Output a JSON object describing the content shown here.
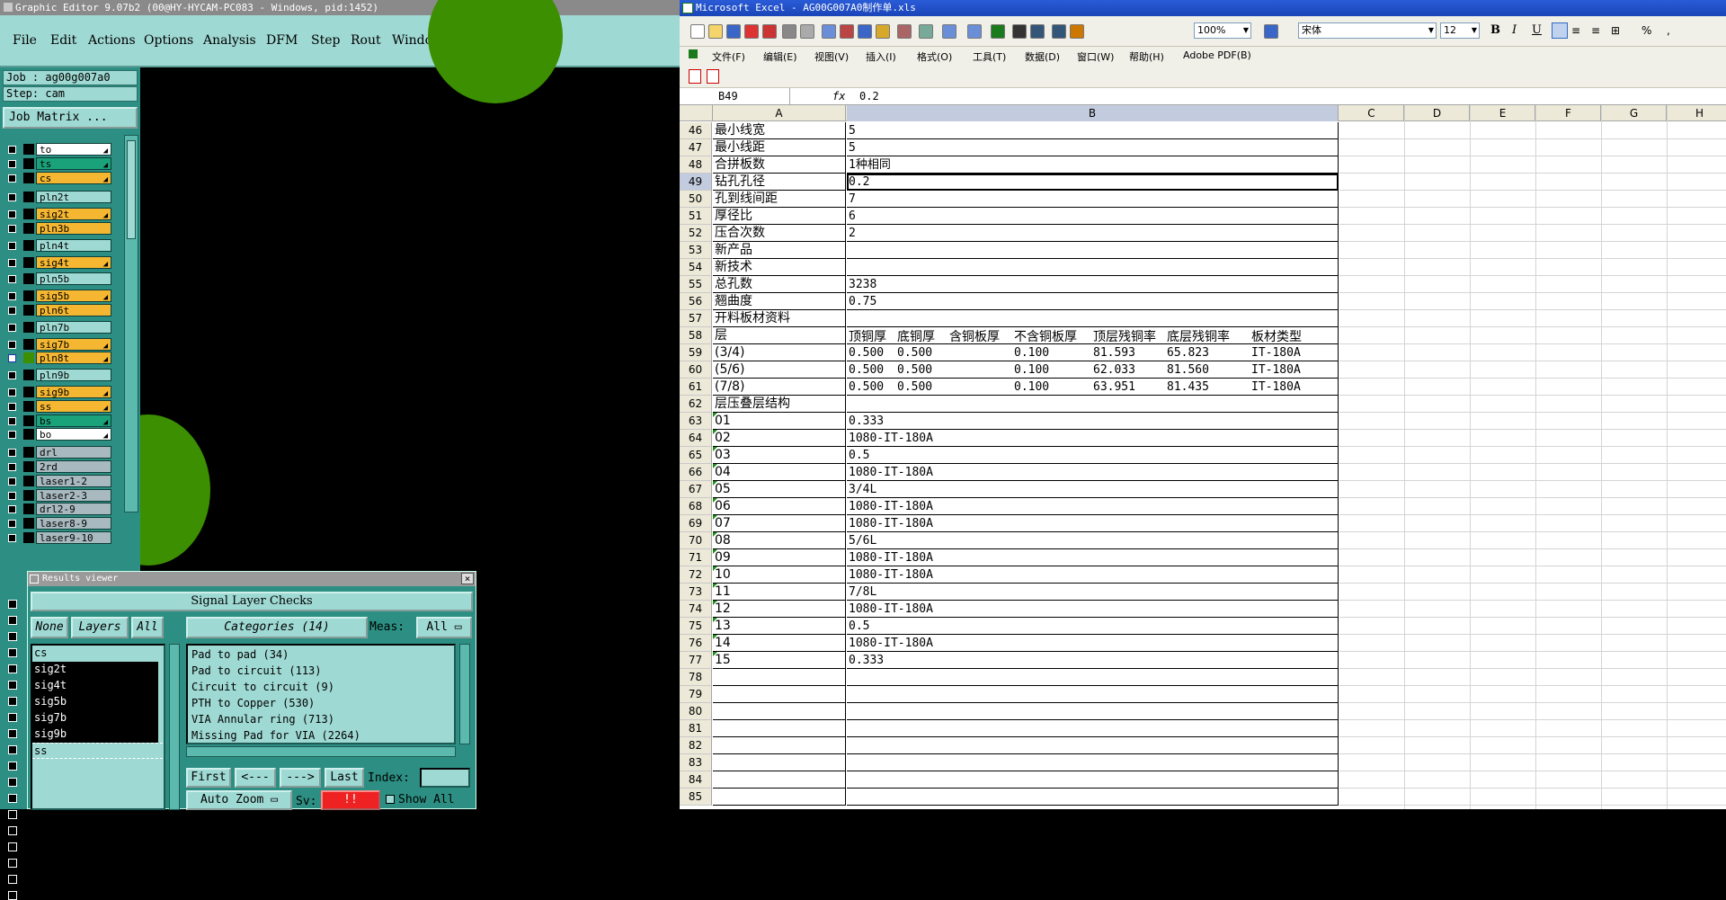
{
  "ge": {
    "title": "Graphic Editor 9.07b2 (00@HY-HYCAM-PC083 - Windows, pid:1452)",
    "menu": [
      "File",
      "Edit",
      "Actions",
      "Options",
      "Analysis",
      "DFM",
      "Step",
      "Rout",
      "Windows"
    ],
    "job": "Job : ag00g007a0",
    "step": "Step: cam",
    "job_matrix": "Job Matrix ...",
    "layers": [
      {
        "name": "to",
        "color": "#ffffff",
        "checked": false,
        "arrow": true
      },
      {
        "name": "ts",
        "color": "#1aa37a",
        "checked": false,
        "arrow": true
      },
      {
        "name": "cs",
        "color": "#f5b731",
        "checked": false,
        "arrow": true
      },
      {
        "name": "pln2t",
        "color": "#9fd9d3",
        "checked": false,
        "arrow": false
      },
      {
        "name": "sig2t",
        "color": "#f5b731",
        "checked": false,
        "arrow": true
      },
      {
        "name": "pln3b",
        "color": "#f5b731",
        "checked": false,
        "arrow": false
      },
      {
        "name": "pln4t",
        "color": "#9fd9d3",
        "checked": false,
        "arrow": false
      },
      {
        "name": "sig4t",
        "color": "#f5b731",
        "checked": false,
        "arrow": true
      },
      {
        "name": "pln5b",
        "color": "#9fd9d3",
        "checked": false,
        "arrow": false
      },
      {
        "name": "sig5b",
        "color": "#f5b731",
        "checked": false,
        "arrow": true
      },
      {
        "name": "pln6t",
        "color": "#f5b731",
        "checked": false,
        "arrow": false
      },
      {
        "name": "pln7b",
        "color": "#9fd9d3",
        "checked": false,
        "arrow": false
      },
      {
        "name": "sig7b",
        "color": "#f5b731",
        "checked": false,
        "arrow": true
      },
      {
        "name": "pln8t",
        "color": "#f5b731",
        "checked": true,
        "arrow": true
      },
      {
        "name": "pln9b",
        "color": "#9fd9d3",
        "checked": false,
        "arrow": false
      },
      {
        "name": "sig9b",
        "color": "#f5b731",
        "checked": false,
        "arrow": true
      },
      {
        "name": "ss",
        "color": "#f5b731",
        "checked": false,
        "arrow": true
      },
      {
        "name": "bs",
        "color": "#1aa37a",
        "checked": false,
        "arrow": true
      },
      {
        "name": "bo",
        "color": "#ffffff",
        "checked": false,
        "arrow": true
      },
      {
        "name": "drl",
        "color": "#a9b9c0",
        "checked": false,
        "arrow": false
      },
      {
        "name": "2rd",
        "color": "#a9b9c0",
        "checked": false,
        "arrow": false
      },
      {
        "name": "laser1-2",
        "color": "#a9b9c0",
        "checked": false,
        "arrow": false
      },
      {
        "name": "laser2-3",
        "color": "#a9b9c0",
        "checked": false,
        "arrow": false
      },
      {
        "name": "drl2-9",
        "color": "#a9b9c0",
        "checked": false,
        "arrow": false
      },
      {
        "name": "laser8-9",
        "color": "#a9b9c0",
        "checked": false,
        "arrow": false
      },
      {
        "name": "laser9-10",
        "color": "#a9b9c0",
        "checked": false,
        "arrow": false
      }
    ],
    "results": {
      "title": "Results viewer",
      "header": "Signal Layer Checks",
      "none": "None",
      "layers_btn": "Layers",
      "all": "All",
      "categories_btn": "Categories (14)",
      "meas_label": "Meas:",
      "meas_value": "All",
      "layer_list": [
        {
          "name": "cs",
          "sel": false
        },
        {
          "name": "sig2t",
          "sel": true
        },
        {
          "name": "sig4t",
          "sel": true
        },
        {
          "name": "sig5b",
          "sel": true
        },
        {
          "name": "sig7b",
          "sel": true
        },
        {
          "name": "sig9b",
          "sel": true
        },
        {
          "name": "ss",
          "sel": false
        }
      ],
      "categories": [
        "Pad to pad (34)",
        "Pad to circuit (113)",
        "Circuit to circuit (9)",
        "PTH to Copper (530)",
        "VIA Annular ring (713)",
        "Missing Pad for VIA (2264)"
      ],
      "first": "First",
      "prev": "<---",
      "next": "--->",
      "last": "Last",
      "index": "Index:",
      "auto_zoom": "Auto Zoom",
      "sv": "Sv:",
      "sv_value": "!!",
      "show_all": "Show All"
    }
  },
  "xl": {
    "title": "Microsoft Excel - AG00G007A0制作单.xls",
    "menu": [
      "文件(F)",
      "编辑(E)",
      "视图(V)",
      "插入(I)",
      "格式(O)",
      "工具(T)",
      "数据(D)",
      "窗口(W)",
      "帮助(H)",
      "Adobe PDF(B)"
    ],
    "zoom": "100%",
    "font": "宋体",
    "font_size": "12",
    "name_box": "B49",
    "fx": "fx",
    "formula": "0.2",
    "columns": [
      "A",
      "B",
      "C",
      "D",
      "E",
      "F",
      "G",
      "H"
    ],
    "rows": [
      {
        "n": "46",
        "a": "最小线宽",
        "b": "5"
      },
      {
        "n": "47",
        "a": "最小线距",
        "b": "5"
      },
      {
        "n": "48",
        "a": "合拼板数",
        "b": "1种相同"
      },
      {
        "n": "49",
        "a": "钻孔孔径",
        "b": "0.2",
        "sel": true
      },
      {
        "n": "50",
        "a": "孔到线间距",
        "b": "7"
      },
      {
        "n": "51",
        "a": "厚径比",
        "b": "6"
      },
      {
        "n": "52",
        "a": "压合次数",
        "b": "2"
      },
      {
        "n": "53",
        "a": "新产品",
        "b": ""
      },
      {
        "n": "54",
        "a": "新技术",
        "b": ""
      },
      {
        "n": "55",
        "a": "总孔数",
        "b": "3238"
      },
      {
        "n": "56",
        "a": "翘曲度",
        "b": "0.75"
      },
      {
        "n": "57",
        "a": "开料板材资料",
        "b": ""
      },
      {
        "n": "58",
        "a": "层",
        "b": "",
        "subs": [
          "顶铜厚",
          "底铜厚",
          "含铜板厚",
          "不含铜板厚",
          "顶层残铜率",
          "底层残铜率",
          "板材类型"
        ],
        "hdr": true
      },
      {
        "n": "59",
        "a": "(3/4)",
        "b": "",
        "subs": [
          "0.500",
          "0.500",
          "",
          "0.100",
          "81.593",
          "65.823",
          "IT-180A"
        ]
      },
      {
        "n": "60",
        "a": "(5/6)",
        "b": "",
        "subs": [
          "0.500",
          "0.500",
          "",
          "0.100",
          "62.033",
          "81.560",
          "IT-180A"
        ]
      },
      {
        "n": "61",
        "a": "(7/8)",
        "b": "",
        "subs": [
          "0.500",
          "0.500",
          "",
          "0.100",
          "63.951",
          "81.435",
          "IT-180A"
        ]
      },
      {
        "n": "62",
        "a": "层压叠层结构",
        "b": ""
      },
      {
        "n": "63",
        "a": "01",
        "b": "0.333",
        "tri": true
      },
      {
        "n": "64",
        "a": "02",
        "b": "1080-IT-180A",
        "tri": true
      },
      {
        "n": "65",
        "a": "03",
        "b": "0.5",
        "tri": true
      },
      {
        "n": "66",
        "a": "04",
        "b": "1080-IT-180A",
        "tri": true
      },
      {
        "n": "67",
        "a": "05",
        "b": "3/4L",
        "tri": true
      },
      {
        "n": "68",
        "a": "06",
        "b": "1080-IT-180A",
        "tri": true
      },
      {
        "n": "69",
        "a": "07",
        "b": "1080-IT-180A",
        "tri": true
      },
      {
        "n": "70",
        "a": "08",
        "b": "5/6L",
        "tri": true
      },
      {
        "n": "71",
        "a": "09",
        "b": "1080-IT-180A",
        "tri": true
      },
      {
        "n": "72",
        "a": "10",
        "b": "1080-IT-180A",
        "tri": true
      },
      {
        "n": "73",
        "a": "11",
        "b": "7/8L",
        "tri": true
      },
      {
        "n": "74",
        "a": "12",
        "b": "1080-IT-180A",
        "tri": true
      },
      {
        "n": "75",
        "a": "13",
        "b": "0.5",
        "tri": true
      },
      {
        "n": "76",
        "a": "14",
        "b": "1080-IT-180A",
        "tri": true
      },
      {
        "n": "77",
        "a": "15",
        "b": "0.333",
        "tri": true
      },
      {
        "n": "78",
        "a": "",
        "b": ""
      },
      {
        "n": "79",
        "a": "",
        "b": ""
      },
      {
        "n": "80",
        "a": "",
        "b": ""
      },
      {
        "n": "81",
        "a": "",
        "b": ""
      },
      {
        "n": "82",
        "a": "",
        "b": ""
      },
      {
        "n": "83",
        "a": "",
        "b": ""
      },
      {
        "n": "84",
        "a": "",
        "b": ""
      },
      {
        "n": "85",
        "a": "",
        "b": ""
      }
    ]
  }
}
